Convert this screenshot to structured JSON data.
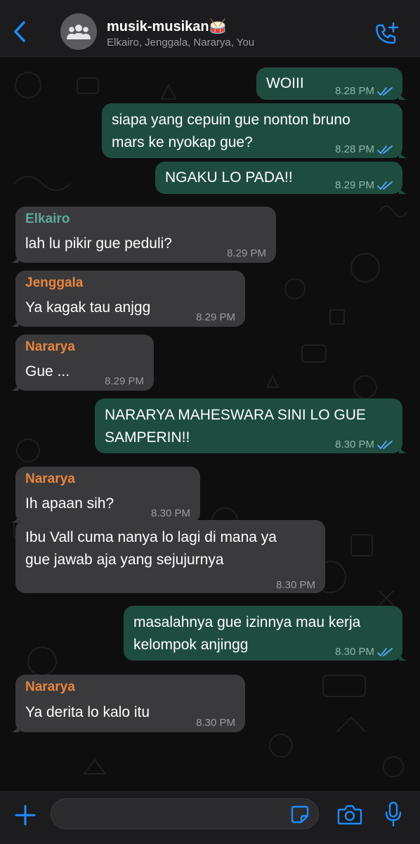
{
  "header": {
    "group_name": "musik-musikan🥁",
    "members": "Elkairo, Jenggala, Nararya, You"
  },
  "colors": {
    "outgoing_bubble": "#1e4d40",
    "incoming_bubble": "#3a3a3c",
    "accent": "#1e8cff",
    "sender_elkairo": "#5fa89a",
    "sender_orange": "#e8853d"
  },
  "messages": [
    {
      "direction": "out",
      "lines": [
        "WOIII"
      ],
      "time": "8.28 PM",
      "status": "read"
    },
    {
      "direction": "out",
      "lines": [
        "siapa yang cepuin gue nonton bruno",
        "mars ke nyokap gue?"
      ],
      "time": "8.28 PM",
      "status": "read"
    },
    {
      "direction": "out",
      "lines": [
        "NGAKU LO PADA!!"
      ],
      "time": "8.29 PM",
      "status": "read"
    },
    {
      "direction": "in",
      "sender": "Elkairo",
      "lines": [
        "lah lu pikir gue peduli?"
      ],
      "time": "8.29 PM"
    },
    {
      "direction": "in",
      "sender": "Jenggala",
      "lines": [
        "Ya kagak tau anjgg"
      ],
      "time": "8.29 PM"
    },
    {
      "direction": "in",
      "sender": "Nararya",
      "lines": [
        "Gue ..."
      ],
      "time": "8.29 PM"
    },
    {
      "direction": "out",
      "lines": [
        "NARARYA MAHESWARA SINI LO GUE",
        "SAMPERIN!!"
      ],
      "time": "8.30 PM",
      "status": "read"
    },
    {
      "direction": "in",
      "sender": "Nararya",
      "lines": [
        "Ih apaan sih?"
      ],
      "time": "8.30 PM"
    },
    {
      "direction": "in",
      "sender": "",
      "lines": [
        "Ibu Vall cuma nanya lo lagi di mana ya",
        "gue jawab aja yang sejujurnya"
      ],
      "time": "8.30 PM"
    },
    {
      "direction": "out",
      "lines": [
        "masalahnya gue izinnya mau kerja",
        "kelompok anjingg"
      ],
      "time": "8.30 PM",
      "status": "read"
    },
    {
      "direction": "in",
      "sender": "Nararya",
      "lines": [
        "Ya derita lo kalo itu"
      ],
      "time": "8.30 PM"
    }
  ],
  "composer": {
    "placeholder": ""
  },
  "icons": {
    "back": "chevron-left-icon",
    "avatar": "group-icon",
    "call": "add-call-icon",
    "plus": "plus-icon",
    "sticker": "sticker-icon",
    "camera": "camera-icon",
    "mic": "microphone-icon",
    "read": "double-check-icon"
  }
}
